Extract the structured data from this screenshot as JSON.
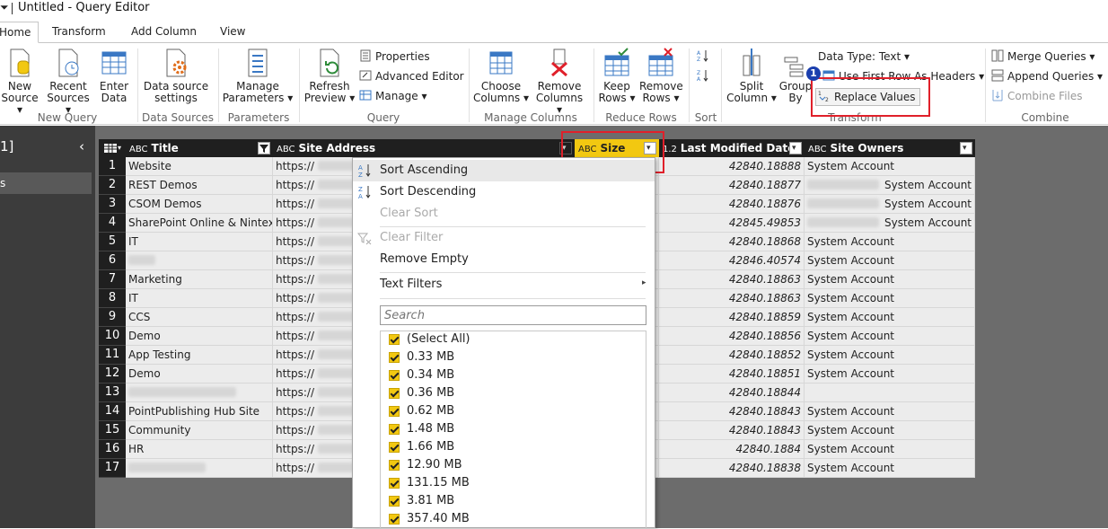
{
  "window": {
    "menu_glyph": "⏷",
    "title": "Untitled - Query Editor"
  },
  "tabs": [
    {
      "label": "Home",
      "active": true
    },
    {
      "label": "Transform"
    },
    {
      "label": "Add Column"
    },
    {
      "label": "View"
    }
  ],
  "ribbon": {
    "new_query": {
      "group_label": "New Query",
      "new_source_l1": "New",
      "new_source_l2": "Source",
      "recent_sources_l1": "Recent",
      "recent_sources_l2": "Sources",
      "enter_data_l1": "Enter",
      "enter_data_l2": "Data"
    },
    "data_sources": {
      "group_label": "Data Sources",
      "settings_l1": "Data source",
      "settings_l2": "settings"
    },
    "parameters": {
      "group_label": "Parameters",
      "manage_l1": "Manage",
      "manage_l2": "Parameters"
    },
    "query": {
      "group_label": "Query",
      "refresh_l1": "Refresh",
      "refresh_l2": "Preview",
      "properties": "Properties",
      "advanced_editor": "Advanced Editor",
      "manage": "Manage"
    },
    "manage_columns": {
      "group_label": "Manage Columns",
      "choose_l1": "Choose",
      "choose_l2": "Columns",
      "remove_l1": "Remove",
      "remove_l2": "Columns"
    },
    "reduce_rows": {
      "group_label": "Reduce Rows",
      "keep_l1": "Keep",
      "keep_l2": "Rows",
      "remove_l1": "Remove",
      "remove_l2": "Rows"
    },
    "sort": {
      "group_label": "Sort"
    },
    "transform": {
      "group_label": "Transform",
      "split_l1": "Split",
      "split_l2": "Column",
      "group_l1": "Group",
      "group_l2": "By",
      "data_type": "Data Type: Text",
      "first_row_headers": "Use First Row As Headers",
      "replace_values": "Replace Values",
      "badge": "1"
    },
    "combine": {
      "group_label": "Combine",
      "merge": "Merge Queries",
      "append": "Append Queries",
      "combine_files": "Combine Files"
    }
  },
  "queries_pane": {
    "header": "1]",
    "chevron": "‹",
    "item": "s"
  },
  "grid": {
    "columns": [
      {
        "name": "Title",
        "type": "ABC"
      },
      {
        "name": "Site Address",
        "type": "ABC"
      },
      {
        "name": "Size",
        "type": "ABC"
      },
      {
        "name": "Last Modified Date",
        "type": "1.2"
      },
      {
        "name": "Site Owners",
        "type": "ABC"
      }
    ],
    "rows": [
      {
        "n": "1",
        "title": "Website",
        "addr": "https://",
        "date": "42840.18888",
        "owner1": "System Account",
        "owner2": ""
      },
      {
        "n": "2",
        "title": "REST Demos",
        "addr": "https://",
        "date": "42840.18877",
        "owner1": "",
        "owner2": "System Account"
      },
      {
        "n": "3",
        "title": "CSOM Demos",
        "addr": "https://",
        "date": "42840.18876",
        "owner1": "",
        "owner2": "System Account"
      },
      {
        "n": "4",
        "title": "SharePoint Online & Nintex",
        "addr": "https://",
        "date": "42845.49853",
        "owner1": "",
        "owner2": "System Account"
      },
      {
        "n": "5",
        "title": "IT",
        "addr": "https://",
        "date": "42840.18868",
        "owner1": "System Account",
        "owner2": ""
      },
      {
        "n": "6",
        "title": "",
        "addr": "https://",
        "date": "42846.40574",
        "owner1": "System Account",
        "owner2": ""
      },
      {
        "n": "7",
        "title": "Marketing",
        "addr": "https://",
        "date": "42840.18863",
        "owner1": "System Account",
        "owner2": ""
      },
      {
        "n": "8",
        "title": "IT",
        "addr": "https://",
        "date": "42840.18863",
        "owner1": "System Account",
        "owner2": ""
      },
      {
        "n": "9",
        "title": "CCS",
        "addr": "https://",
        "date": "42840.18859",
        "owner1": "System Account",
        "owner2": ""
      },
      {
        "n": "10",
        "title": "Demo",
        "addr": "https://",
        "date": "42840.18856",
        "owner1": "System Account",
        "owner2": ""
      },
      {
        "n": "11",
        "title": "App Testing",
        "addr": "https://",
        "date": "42840.18852",
        "owner1": "System Account",
        "owner2": ""
      },
      {
        "n": "12",
        "title": "Demo",
        "addr": "https://",
        "date": "42840.18851",
        "owner1": "System Account",
        "owner2": ""
      },
      {
        "n": "13",
        "title": "",
        "addr": "https://",
        "date": "42840.18844",
        "owner1": "",
        "owner2": ""
      },
      {
        "n": "14",
        "title": "PointPublishing Hub Site",
        "addr": "https://",
        "date": "42840.18843",
        "owner1": "System Account",
        "owner2": ""
      },
      {
        "n": "15",
        "title": "Community",
        "addr": "https://",
        "date": "42840.18843",
        "owner1": "System Account",
        "owner2": ""
      },
      {
        "n": "16",
        "title": "HR",
        "addr": "https://",
        "date": "42840.1884",
        "owner1": "System Account",
        "owner2": ""
      },
      {
        "n": "17",
        "title": "",
        "addr": "https://",
        "date": "42840.18838",
        "owner1": "System Account",
        "owner2": ""
      }
    ]
  },
  "filter_menu": {
    "sort_asc": "Sort Ascending",
    "sort_desc": "Sort Descending",
    "clear_sort": "Clear Sort",
    "clear_filter": "Clear Filter",
    "remove_empty": "Remove Empty",
    "text_filters": "Text Filters",
    "search_placeholder": "Search",
    "values": [
      "(Select All)",
      "0.33 MB",
      "0.34 MB",
      "0.36 MB",
      "0.62 MB",
      "1.48 MB",
      "1.66 MB",
      "12.90 MB",
      "131.15 MB",
      "3.81 MB",
      "357.40 MB"
    ]
  },
  "colors": {
    "accent": "#f2c811",
    "highlight_box": "#e0202a",
    "badge": "#1b3fae"
  }
}
